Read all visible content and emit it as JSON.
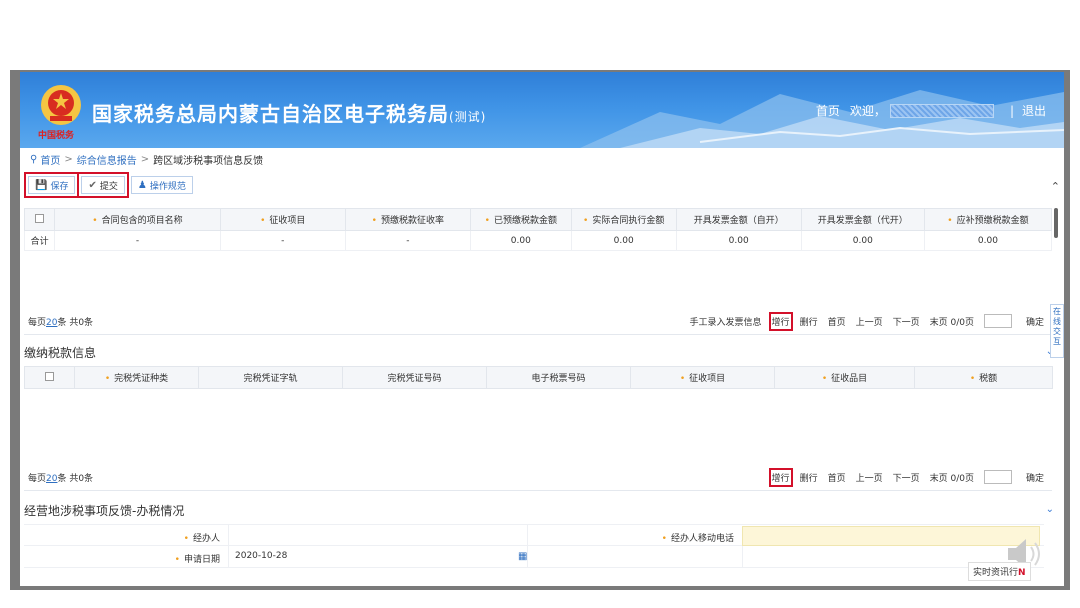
{
  "header": {
    "logo_sub": "中国税务",
    "title": "国家税务总局内蒙古自治区电子税务局",
    "title_suffix": "(测试)",
    "nav_home": "首页",
    "nav_welcome": "欢迎，",
    "nav_sep": "|",
    "nav_logout": "退出"
  },
  "breadcrumb": {
    "items": [
      "首页",
      "综合信息报告",
      "跨区域涉税事项信息反馈"
    ],
    "arrow": ">"
  },
  "toolbar": {
    "save": "保存",
    "submit": "提交",
    "guide": "操作规范"
  },
  "table1": {
    "headers": [
      "合同包含的项目名称",
      "征收项目",
      "预缴税款征收率",
      "已预缴税款金额",
      "实际合同执行金额",
      "开具发票金额（自开）",
      "开具发票金额（代开）",
      "应补预缴税款金额"
    ],
    "total_row": [
      "合计",
      "-",
      "-",
      "-",
      "0.00",
      "0.00",
      "0.00",
      "0.00",
      "0.00"
    ]
  },
  "pager1": {
    "per_page_prefix": "每页",
    "per_page": "20",
    "per_page_suffix": "条 共0条",
    "manual": "手工录入发票信息",
    "add_row": "增行",
    "del_row": "删行",
    "first": "首页",
    "prev": "上一页",
    "next": "下一页",
    "last": "末页 0/0页",
    "confirm": "确定"
  },
  "section2": {
    "title": "缴纳税款信息",
    "headers": [
      "完税凭证种类",
      "完税凭证字轨",
      "完税凭证号码",
      "电子税票号码",
      "征收项目",
      "征收品目",
      "税额"
    ]
  },
  "pager2": {
    "per_page_prefix": "每页",
    "per_page": "20",
    "per_page_suffix": "条 共0条",
    "add_row": "增行",
    "del_row": "删行",
    "first": "首页",
    "prev": "上一页",
    "next": "下一页",
    "last": "末页 0/0页",
    "confirm": "确定"
  },
  "section3": {
    "title": "经营地涉税事项反馈-办税情况",
    "handler_label": "经办人",
    "handler_phone_label": "经办人移动电话",
    "date_label": "申请日期",
    "date_value": "2020-10-28"
  },
  "side_tab": "在线交互",
  "chat": {
    "label": "实时资讯",
    "suffix": "行",
    "badge": "N"
  },
  "colors": {
    "header_blue": "#3f93e6",
    "link_blue": "#2f6fc0",
    "highlight_red": "#d3102a",
    "required_orange": "#f0a020"
  }
}
